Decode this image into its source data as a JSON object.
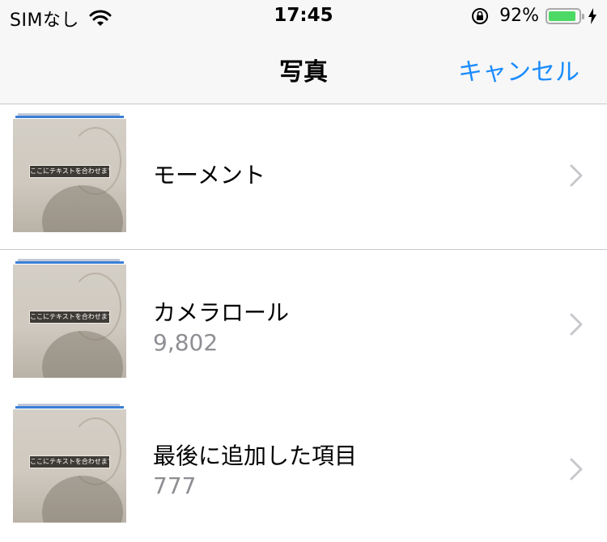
{
  "status_bar": {
    "carrier": "SIMなし",
    "time": "17:45",
    "battery_percent": "92%",
    "battery_level": 0.92,
    "icons": [
      "wifi-icon",
      "orientation-lock-icon",
      "battery-icon",
      "charging-bolt-icon"
    ],
    "battery_color": "#4cd964"
  },
  "nav": {
    "title": "写真",
    "cancel_label": "キャンセル",
    "accent_color": "#1a8cff"
  },
  "albums": [
    {
      "title": "モーメント",
      "count": "",
      "thumbnail_caption": "ここにテキストを合わせます"
    },
    {
      "title": "カメラロール",
      "count": "9,802",
      "thumbnail_caption": "ここにテキストを合わせます"
    },
    {
      "title": "最後に追加した項目",
      "count": "777",
      "thumbnail_caption": "ここにテキストを合わせます"
    }
  ]
}
